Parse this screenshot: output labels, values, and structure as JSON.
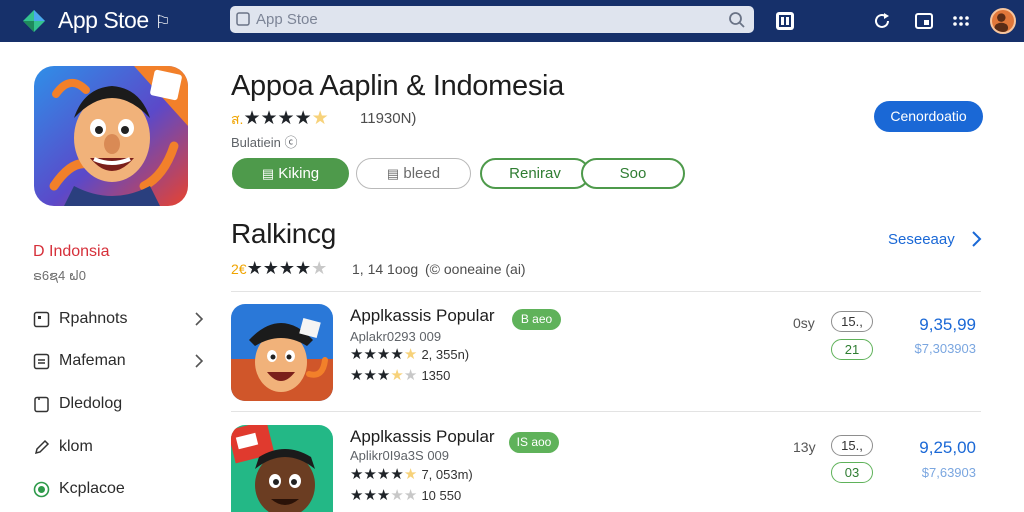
{
  "topbar": {
    "title": "App Stoe",
    "title_glyph": "⚐",
    "search_placeholder": "App Stoe",
    "icons": [
      "logo-icon",
      "search-icon",
      "store-icon",
      "refresh-icon",
      "window-icon",
      "apps-grid-icon",
      "avatar"
    ]
  },
  "sidebar": {
    "country": "D Indonsia",
    "country_sub": "ຣ6ຊ4 ຝ0",
    "items": [
      {
        "label": "Rpahnots",
        "icon": "square-icon",
        "chevron": true
      },
      {
        "label": "Mafeman",
        "icon": "list-icon",
        "chevron": true
      },
      {
        "label": "Dledolog",
        "icon": "tablet-icon",
        "chevron": false
      },
      {
        "label": "klom",
        "icon": "pencil-icon",
        "chevron": false
      },
      {
        "label": "Kcplacoe",
        "icon": "record-icon",
        "chevron": false
      }
    ]
  },
  "header": {
    "app_name": "Appoa Aaplin & Indomesia",
    "rating_value": "ส.",
    "rating_stars": 4.5,
    "rating_count": "11930N)",
    "subtitle": "Bulatiein ⓒ",
    "primary_button": "Cenordoatio",
    "pills": [
      {
        "label": "Kiking",
        "style": "green",
        "icon": "save-icon"
      },
      {
        "label": "bleed",
        "style": "gray",
        "icon": "save-icon"
      },
      {
        "label": "Renirav",
        "style": "outline",
        "icon": ""
      },
      {
        "label": "Soo",
        "style": "outline",
        "icon": ""
      }
    ]
  },
  "ranking": {
    "title": "Ralkincg",
    "see_all": "Seseeaay",
    "rating_value": "2€",
    "rating_stars": 4,
    "rating_count": "1, 14 1oog",
    "note": "(© ooneaine (ai)"
  },
  "list": [
    {
      "title": "Applkassis Popular",
      "subtitle": "Aplakr0293 009",
      "badge": "B aeo",
      "stars1": 4.5,
      "stars1_text": "2, 355n)",
      "stars2": 3.5,
      "stars2_text": "1350",
      "rank": "0sy",
      "chip1": "15.,",
      "chip2": "21",
      "price": "9,35,99",
      "price_old": "$7,303903"
    },
    {
      "title": "Applkassis Popular",
      "subtitle": "Aplikr0I9a3S 009",
      "badge": "IS aoo",
      "stars1": 4.5,
      "stars1_text": "7, 053m)",
      "stars2": 3,
      "stars2_text": "10 550",
      "rank": "13y",
      "chip1": "15.,",
      "chip2": "03",
      "price": "9,25,00",
      "price_old": "$7,63903"
    }
  ],
  "colors": {
    "topbar": "#16306a",
    "accent_blue": "#1a68d6",
    "accent_green": "#4e9a4b",
    "star": "#f4b400",
    "country_red": "#d6303a"
  }
}
